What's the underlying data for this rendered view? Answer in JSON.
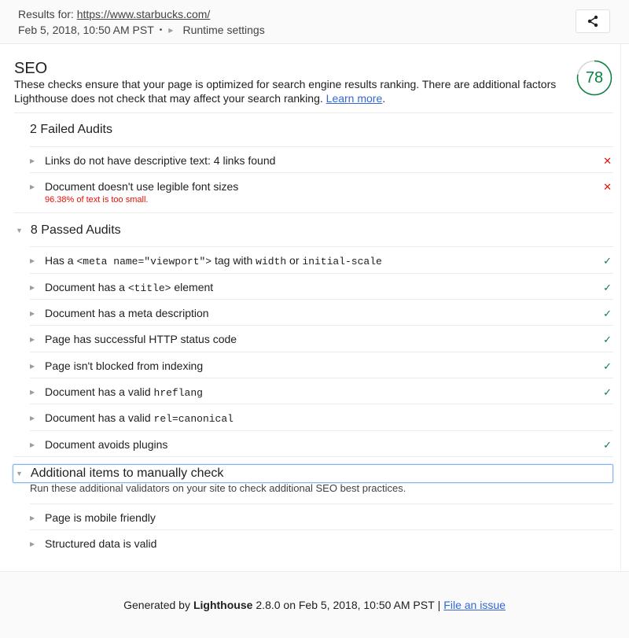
{
  "header": {
    "results_for_label": "Results for:",
    "url": "https://www.starbucks.com/",
    "timestamp": "Feb 5, 2018, 10:50 AM PST",
    "separator": "•",
    "runtime_settings_label": "Runtime settings",
    "share_icon": "share-icon"
  },
  "category": {
    "title": "SEO",
    "description": "These checks ensure that your page is optimized for search engine results ranking. There are additional factors Lighthouse does not check that may affect your search ranking.",
    "learn_more_label": "Learn more",
    "learn_more_suffix": ".",
    "score": "78",
    "score_fraction": 0.78,
    "score_color": "#0b8043"
  },
  "failed_group": {
    "title": "2 Failed Audits",
    "audits": [
      {
        "text": "Links do not have descriptive text: 4 links found",
        "status": "fail",
        "status_icon": "✕"
      },
      {
        "text": "Document doesn't use legible font sizes",
        "status": "fail",
        "status_icon": "✕",
        "subtext": "96.38% of text is too small."
      }
    ]
  },
  "passed_group": {
    "title": "8 Passed Audits",
    "audits": [
      {
        "parts": [
          "Has a ",
          "<meta name=\"viewport\">",
          " tag with ",
          "width",
          " or ",
          "initial-scale"
        ],
        "status": "pass",
        "status_icon": "✓"
      },
      {
        "parts": [
          "Document has a ",
          "<title>",
          " element"
        ],
        "status": "pass",
        "status_icon": "✓"
      },
      {
        "text": "Document has a meta description",
        "status": "pass",
        "status_icon": "✓"
      },
      {
        "text": "Page has successful HTTP status code",
        "status": "pass",
        "status_icon": "✓"
      },
      {
        "text": "Page isn't blocked from indexing",
        "status": "pass",
        "status_icon": "✓"
      },
      {
        "parts": [
          "Document has a valid ",
          "hreflang"
        ],
        "status": "pass",
        "status_icon": "✓"
      },
      {
        "parts": [
          "Document has a valid ",
          "rel=canonical"
        ],
        "status": "none",
        "status_icon": ""
      },
      {
        "text": "Document avoids plugins",
        "status": "pass",
        "status_icon": "✓"
      }
    ]
  },
  "manual_group": {
    "title": "Additional items to manually check",
    "description": "Run these additional validators on your site to check additional SEO best practices.",
    "audits": [
      {
        "text": "Page is mobile friendly"
      },
      {
        "text": "Structured data is valid"
      }
    ]
  },
  "footer": {
    "generated_by": "Generated by",
    "product": "Lighthouse",
    "version_text": "2.8.0 on Feb 5, 2018, 10:50 AM PST",
    "separator": "|",
    "file_issue_label": "File an issue"
  }
}
